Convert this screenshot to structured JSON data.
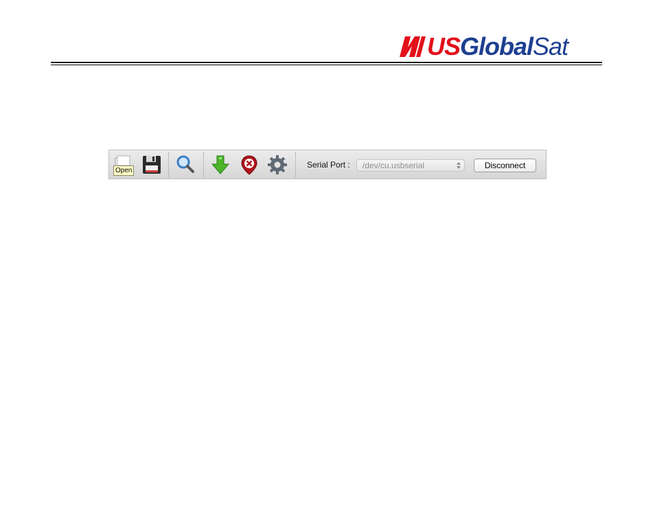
{
  "header": {
    "logo": {
      "brand_us": "US",
      "brand_global": "Global",
      "brand_sat": "Sat",
      "colors": {
        "red": "#e3101a",
        "blue": "#1d3f91"
      }
    }
  },
  "toolbar": {
    "buttons": [
      {
        "name": "open",
        "icon": "open-folder-icon"
      },
      {
        "name": "save",
        "icon": "floppy-disk-icon"
      },
      {
        "name": "search",
        "icon": "magnifier-icon"
      },
      {
        "name": "download",
        "icon": "green-down-arrow-icon"
      },
      {
        "name": "delete",
        "icon": "red-x-marker-icon"
      },
      {
        "name": "settings",
        "icon": "gear-icon"
      }
    ],
    "tooltip": "Open",
    "serial_port_label": "Serial Port :",
    "serial_port_value": "/dev/cu.usbserial",
    "disconnect_label": "Disconnect"
  }
}
